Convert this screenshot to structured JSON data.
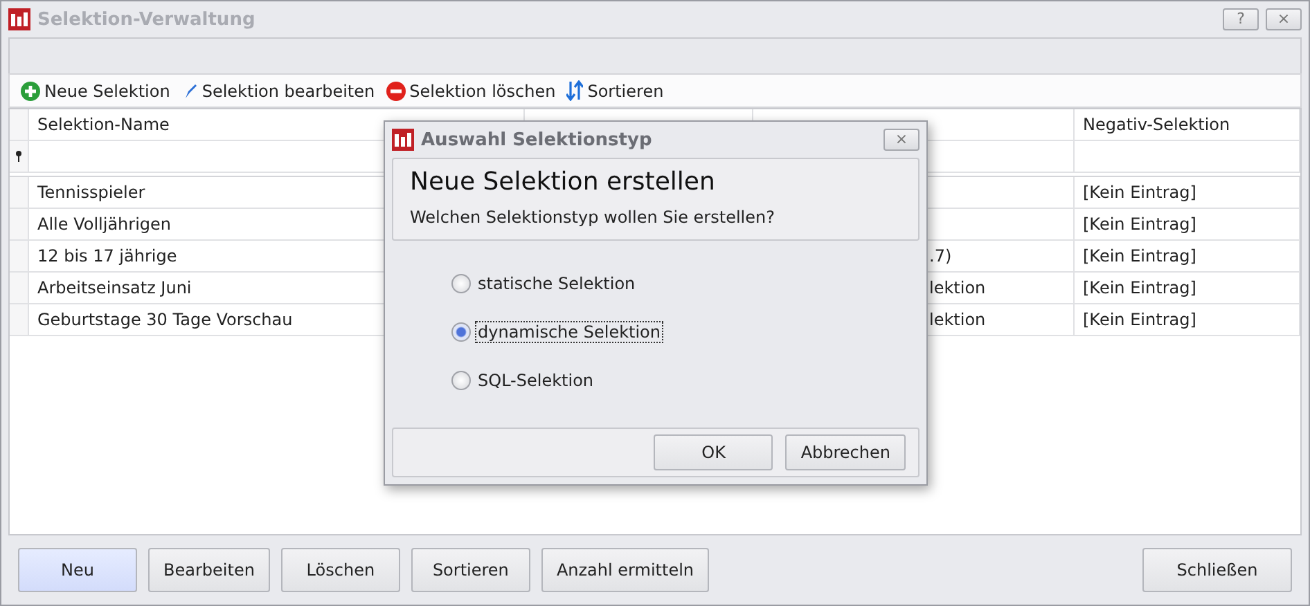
{
  "window": {
    "title": "Selektion-Verwaltung",
    "controls": [
      "?",
      "×"
    ]
  },
  "toolbar": [
    {
      "kind": "add",
      "label": "Neue Selektion"
    },
    {
      "kind": "edit",
      "label": "Selektion bearbeiten"
    },
    {
      "kind": "delete",
      "label": "Selektion löschen"
    },
    {
      "kind": "sort",
      "label": "Sortieren"
    }
  ],
  "table": {
    "columns": [
      "Selektion-Name",
      "Negativ-Selektion"
    ],
    "rows": [
      {
        "name": "Tennisspieler",
        "column_3": "",
        "negative": "[Kein Eintrag]"
      },
      {
        "name": "Alle Volljährigen",
        "column_3": "",
        "negative": "[Kein Eintrag]"
      },
      {
        "name": "12 bis 17 jährige",
        "column_3": ".7)",
        "negative": "[Kein Eintrag]"
      },
      {
        "name": "Arbeitseinsatz Juni",
        "column_3": "lektion",
        "negative": "[Kein Eintrag]"
      },
      {
        "name": "Geburtstage 30 Tage Vorschau",
        "column_3": "lektion",
        "negative": "[Kein Eintrag]"
      }
    ]
  },
  "buttons": [
    {
      "label": "Neu",
      "selected": true
    },
    {
      "label": "Bearbeiten",
      "selected": false
    },
    {
      "label": "Löschen",
      "selected": false
    },
    {
      "label": "Sortieren",
      "selected": false
    },
    {
      "label": "Anzahl ermitteln",
      "selected": false
    }
  ],
  "close_button": "Schließen",
  "dialog": {
    "title": "Auswahl Selektionstyp",
    "close": "×",
    "heading": "Neue Selektion erstellen",
    "question": "Welchen Selektionstyp wollen Sie erstellen?",
    "options": [
      {
        "label": "statische Selektion",
        "selected": false
      },
      {
        "label": "dynamische Selektion",
        "selected": true
      },
      {
        "label": "SQL-Selektion",
        "selected": false
      }
    ],
    "buttons": [
      "OK",
      "Abbrechen"
    ]
  }
}
